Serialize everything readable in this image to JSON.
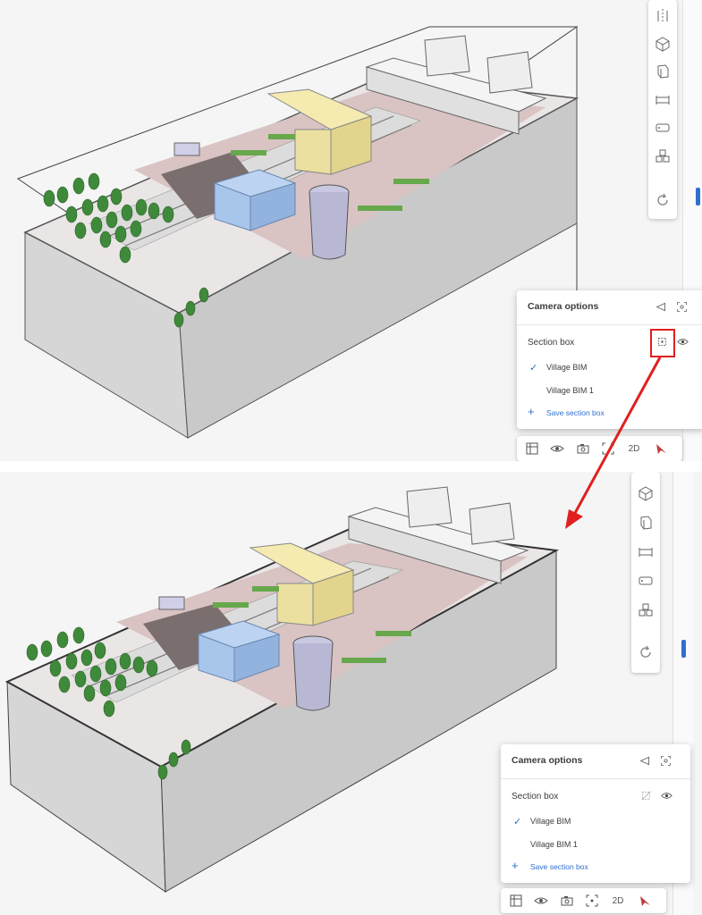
{
  "top_panel": {
    "camera_card": {
      "title": "Camera options",
      "section_box_label": "Section box",
      "section_box_state": "enabled",
      "items": [
        {
          "label": "Village BIM",
          "checked": true
        },
        {
          "label": "Village BIM 1",
          "checked": false
        }
      ],
      "save_label": "Save section box",
      "highlighted": true
    },
    "bottom_toolbar": {
      "text_2d": "2D"
    },
    "side_toolbar_icons": [
      "section-plane-icon",
      "cube-icon",
      "box-front-icon",
      "measure-icon",
      "tag-icon",
      "stacked-cubes-icon",
      "rotate-icon"
    ]
  },
  "bottom_panel": {
    "camera_card": {
      "title": "Camera options",
      "section_box_label": "Section box",
      "section_box_state": "disabled",
      "items": [
        {
          "label": "Village BIM",
          "checked": true
        },
        {
          "label": "Village BIM 1",
          "checked": false
        }
      ],
      "save_label": "Save section box",
      "highlighted": false
    },
    "bottom_toolbar": {
      "text_2d": "2D"
    },
    "side_toolbar_icons": [
      "cube-icon",
      "box-front-icon",
      "measure-icon",
      "tag-icon",
      "stacked-cubes-icon",
      "rotate-icon"
    ]
  },
  "colors": {
    "accent_blue": "#2e6fd0",
    "highlight_red": "#e02020",
    "tree_green": "#3f8a3a",
    "building_yellow": "#f0e4a0",
    "building_blue": "#a8c6ec",
    "ground_pink": "#cdb4b4"
  }
}
